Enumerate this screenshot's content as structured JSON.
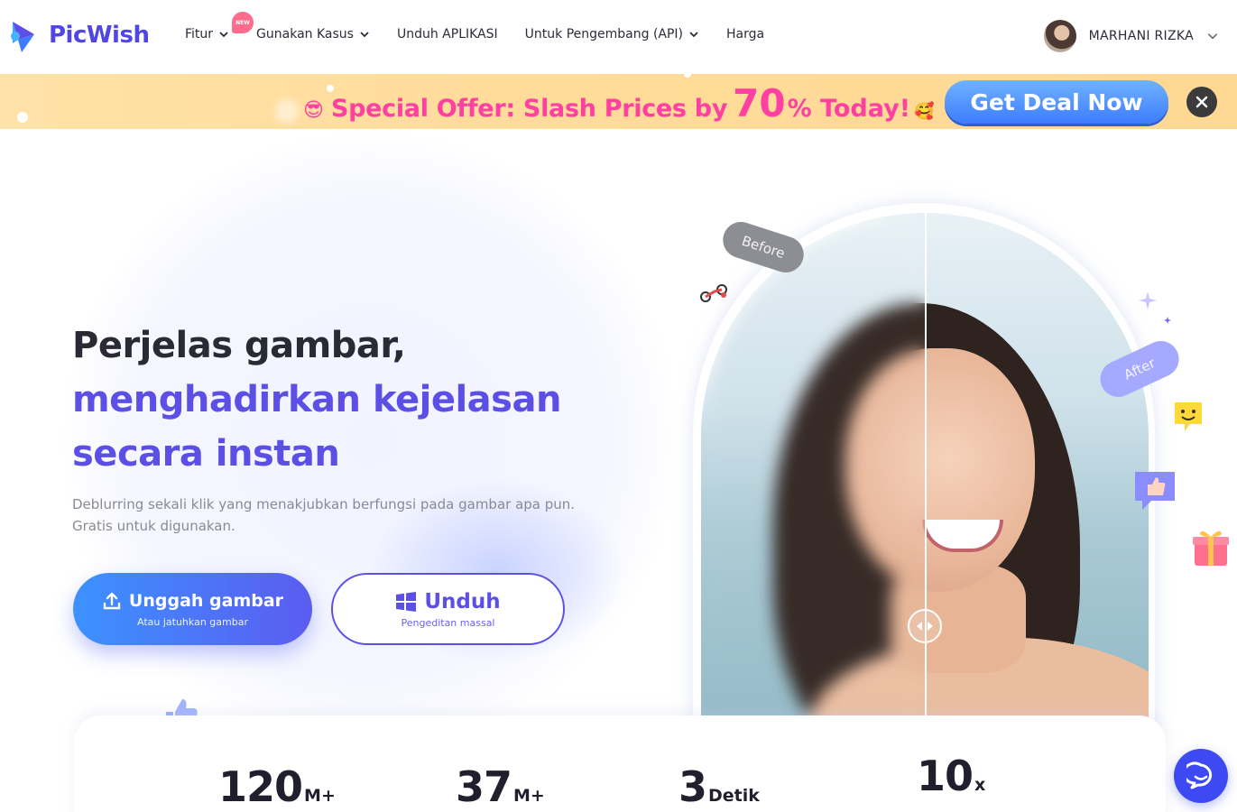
{
  "brand": {
    "name": "PicWish"
  },
  "nav": {
    "items": [
      {
        "label": "Fitur",
        "has_dropdown": true
      },
      {
        "label": "Gunakan Kasus",
        "has_dropdown": true
      },
      {
        "label": "Unduh APLIKASI",
        "has_dropdown": false
      },
      {
        "label": "Untuk Pengembang (API)",
        "has_dropdown": true
      },
      {
        "label": "Harga",
        "has_dropdown": false
      }
    ],
    "new_badge": "NEW"
  },
  "user": {
    "name": "MARHANI RIZKA"
  },
  "promo": {
    "text_before": "Special Offer: Slash Prices by",
    "highlight": "70",
    "text_after": "% Today!",
    "cta_label": "Get Deal Now",
    "background": "#ffdc9a",
    "text_color": "#ff3fa1",
    "cta_color": "#3d7cff"
  },
  "hero": {
    "title_line1": "Perjelas gambar,",
    "title_line2": "menghadirkan kejelasan",
    "title_line3": "secara instan",
    "subtitle": "Deblurring sekali klik yang menakjubkan berfungsi pada gambar apa pun. Gratis untuk digunakan.",
    "upload_button": {
      "label": "Unggah gambar",
      "hint": "Atau jatuhkan gambar"
    },
    "download_button": {
      "label": "Unduh",
      "hint": "Pengeditan massal"
    },
    "accent_color": "#5b4fe6"
  },
  "compare": {
    "before_label": "Before",
    "after_label": "After"
  },
  "stats": [
    {
      "value": "120",
      "unit": "M+"
    },
    {
      "value": "37",
      "unit": "M+"
    },
    {
      "value": "3",
      "unit": "Detik"
    },
    {
      "value": "10",
      "unit": "x"
    }
  ],
  "icons": {
    "logo": "picwish-logo-icon",
    "chevron": "chevron-down-icon",
    "close": "close-icon",
    "upload": "upload-icon",
    "windows": "windows-icon",
    "chat": "chat-icon"
  }
}
